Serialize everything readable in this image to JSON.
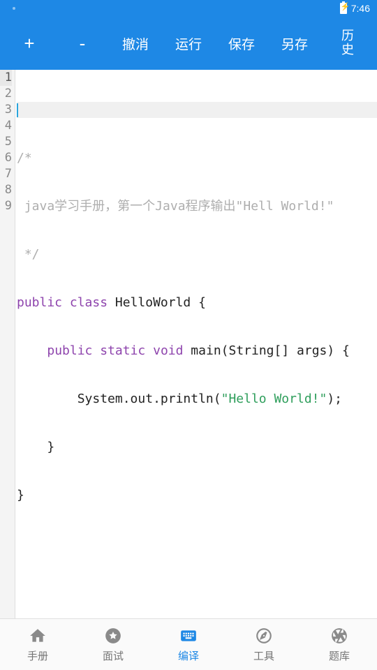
{
  "status": {
    "time": "7:46"
  },
  "toolbar": {
    "plus": "+",
    "minus": "-",
    "undo": "撤消",
    "run": "运行",
    "save": "保存",
    "saveAs": "另存",
    "history_l1": "历",
    "history_l2": "史"
  },
  "code": {
    "lineNumbers": [
      "1",
      "2",
      "3",
      "4",
      "5",
      "6",
      "7",
      "8",
      "9"
    ],
    "currentLine": 1,
    "tokens": {
      "l2": "/*",
      "l3": " java学习手册，第一个Java程序输出\"Hell World!\"",
      "l4": " */",
      "l5_kw1": "public",
      "l5_kw2": "class",
      "l5_rest": " HelloWorld {",
      "l6_indent": "    ",
      "l6_kw1": "public",
      "l6_kw2": "static",
      "l6_kw3": "void",
      "l6_rest": " main(String[] args) {",
      "l7_indent": "        System.out.println(",
      "l7_str": "\"Hello World!\"",
      "l7_rest": ");",
      "l8": "    }",
      "l9": "}"
    }
  },
  "nav": {
    "manual": "手册",
    "interview": "面试",
    "compile": "编译",
    "tools": "工具",
    "questions": "题库"
  }
}
